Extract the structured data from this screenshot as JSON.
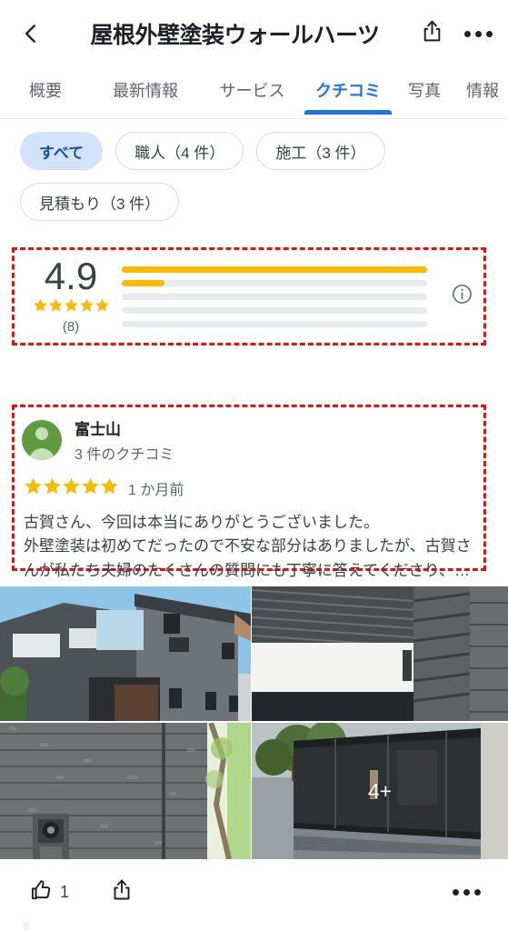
{
  "header": {
    "back_icon": "chevron-left-icon",
    "title": "屋根外壁塗装ウォールハーツ",
    "share_icon": "share-icon",
    "more_icon": "more-options-icon"
  },
  "tabs": [
    {
      "label": "概要",
      "active": false
    },
    {
      "label": "最新情報",
      "active": false
    },
    {
      "label": "サービス",
      "active": false
    },
    {
      "label": "クチコミ",
      "active": true
    },
    {
      "label": "写真",
      "active": false
    },
    {
      "label": "情報",
      "active": false
    }
  ],
  "filters": [
    {
      "label": "すべて",
      "selected": true
    },
    {
      "label": "職人（4 件）",
      "selected": false
    },
    {
      "label": "施工（3 件）",
      "selected": false
    },
    {
      "label": "見積もり（3 件）",
      "selected": false
    }
  ],
  "rating_summary": {
    "score": "4.9",
    "stars": 5,
    "review_count_label": "(8)",
    "info_icon": "info-circle-icon",
    "histogram": [
      {
        "stars": 5,
        "percent": 100
      },
      {
        "stars": 4,
        "percent": 14
      },
      {
        "stars": 3,
        "percent": 0
      },
      {
        "stars": 2,
        "percent": 0
      },
      {
        "stars": 1,
        "percent": 0
      }
    ]
  },
  "review": {
    "avatar_icon": "user-avatar-icon",
    "author": "富士山",
    "author_subtitle": "3 件のクチコミ",
    "stars": 5,
    "date": "1 か月前",
    "text_lines": [
      "古賀さん、今回は本当にありがとうございました。",
      "外壁塗装は初めてだったので不安な部分はありましたが、古賀さ",
      "んが私たち夫婦のたくさんの質問にも丁寧に答えてくださり、…"
    ],
    "photos": [
      {
        "name": "house-exterior-photo",
        "overlay": ""
      },
      {
        "name": "carport-siding-photo",
        "overlay": ""
      },
      {
        "name": "wall-texture-photo",
        "overlay": ""
      },
      {
        "name": "fence-photo",
        "overlay": "4+"
      }
    ],
    "actions": {
      "like_icon": "thumb-up-icon",
      "like_count": "1",
      "share_icon": "share-icon",
      "more_icon": "more-options-icon"
    }
  },
  "colors": {
    "accent_blue": "#1a73e8",
    "chip_selected_bg": "#d2e3fc",
    "star_gold": "#fabb05",
    "annotation_red": "#f20d0d",
    "avatar_green": "#5e9b41"
  }
}
